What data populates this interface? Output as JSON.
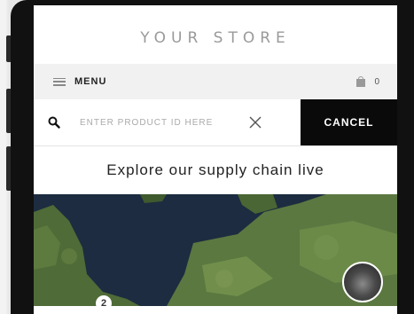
{
  "header": {
    "store_title": "YOUR STORE"
  },
  "menu_bar": {
    "menu_label": "MENU",
    "cart_count": "0"
  },
  "search": {
    "placeholder": "ENTER PRODUCT ID HERE",
    "value": "",
    "cancel_label": "CANCEL"
  },
  "tagline": {
    "text": "Explore our supply chain live"
  },
  "map": {
    "marker_label": "2"
  },
  "icons": {
    "menu": "hamburger-icon",
    "cart": "shopping-bag-icon",
    "search": "search-icon",
    "clear": "close-icon"
  },
  "colors": {
    "cancel_bg": "#0a0a0a",
    "menu_bar_bg": "#f1f1f1",
    "store_title": "#9a9a9a"
  }
}
